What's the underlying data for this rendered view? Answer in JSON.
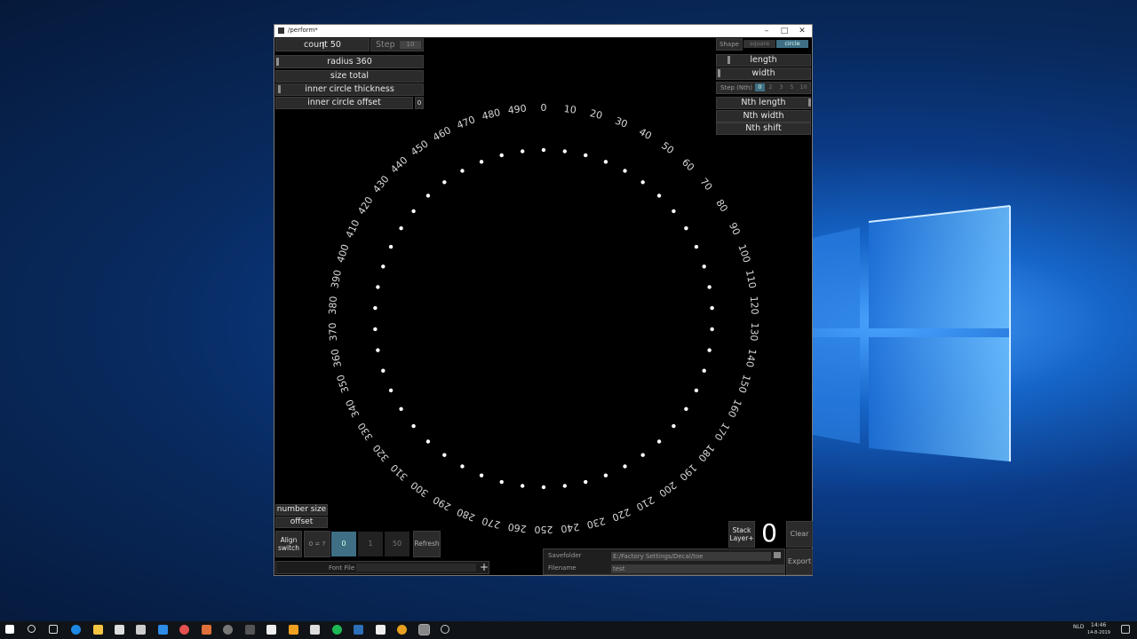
{
  "window": {
    "title": "/perform*",
    "minimize": "–",
    "maximize": "□",
    "close": "✕"
  },
  "left_panel": {
    "count": "count 50",
    "step_label": "Step",
    "step_value": "10",
    "radius": "radius 360",
    "size_total": "size total",
    "inner_circle_thickness": "inner circle thickness",
    "inner_circle_offset": "inner circle offset",
    "inner_circle_offset_value": "0"
  },
  "right_panel": {
    "shape_label": "Shape",
    "shape_options": [
      "square",
      "circle"
    ],
    "shape_selected": "circle",
    "length": "length",
    "width": "width",
    "step_nth_label": "Step (Nth)",
    "step_nth_options": [
      "0",
      "2",
      "3",
      "5",
      "10"
    ],
    "step_nth_selected": "0",
    "nth_length": "Nth length",
    "nth_width": "Nth width",
    "nth_shift": "Nth shift"
  },
  "dial": {
    "labels": [
      "0",
      "10",
      "20",
      "30",
      "40",
      "50",
      "60",
      "70",
      "80",
      "90",
      "100",
      "110",
      "120",
      "130",
      "140",
      "150",
      "160",
      "170",
      "180",
      "190",
      "200",
      "210",
      "220",
      "230",
      "240",
      "250",
      "260",
      "270",
      "280",
      "290",
      "300",
      "310",
      "320",
      "330",
      "340",
      "350",
      "360",
      "370",
      "380",
      "390",
      "400",
      "410",
      "420",
      "430",
      "440",
      "450",
      "460",
      "470",
      "480",
      "490"
    ],
    "dot_count": 50
  },
  "bottom_left": {
    "number_size": "number size",
    "offset": "offset",
    "align_switch": "Align switch",
    "zero_eq": "0 = ?",
    "align_options": [
      "0",
      "1",
      "50"
    ],
    "align_selected": "0",
    "refresh": "Refresh",
    "font_file_label": "Font File",
    "font_file_value": "",
    "add": "+"
  },
  "bottom_right": {
    "stack_layer": "Stack Layer+",
    "layer_count": "0",
    "clear": "Clear",
    "savefolder_label": "Savefolder",
    "savefolder_value": "E:/Factory Settings/Decal/toe",
    "filename_label": "Filename",
    "filename_value": "test",
    "export": "Export"
  },
  "taskbar": {
    "time": "14:46",
    "date": "14-8-2019",
    "lang": "NLD"
  },
  "colors": {
    "accent": "#3e6f85",
    "panel": "#2b2b2b",
    "desktop": "#0b3a86"
  }
}
